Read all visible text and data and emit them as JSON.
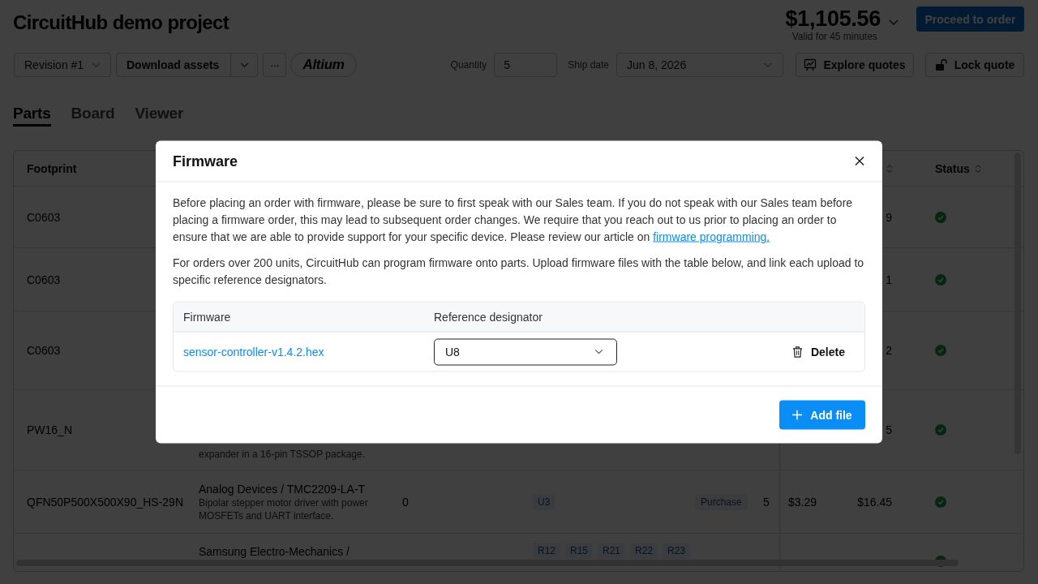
{
  "header": {
    "title": "CircuitHub demo project",
    "price": "$1,105.56",
    "price_note": "Valid for 45 minutes",
    "order_button": "Proceed to order"
  },
  "toolbar": {
    "revision": "Revision #1",
    "download": "Download assets",
    "more": "···",
    "cad_tool": "Altium",
    "quantity": {
      "label": "Quantity",
      "value": "5"
    },
    "ship_date": {
      "label": "Ship date",
      "value": "Jun 8, 2026"
    },
    "explore_button": "Explore quotes",
    "lock_button": "Lock quote"
  },
  "tabs": [
    {
      "label": "Parts",
      "selected": true
    },
    {
      "label": "Board",
      "selected": false
    },
    {
      "label": "Viewer",
      "selected": false
    }
  ],
  "table": {
    "columns": {
      "footprint": {
        "label": "Footprint"
      },
      "column_8": {
        "sortable": true
      },
      "status": {
        "label": "Status",
        "sortable": true
      }
    },
    "rows": [
      {
        "footprint": "C0603",
        "column_8": "9",
        "done": true
      },
      {
        "footprint": "C0603",
        "column_8": "1",
        "done": true
      },
      {
        "footprint": "C0603",
        "column_8": "2",
        "done": true
      },
      {
        "footprint": "PW16_N",
        "column_2": {
          "description": "expander in a 16-pin TSSOP package."
        },
        "column_8": "5",
        "done": true
      },
      {
        "footprint": "QFN50P500X500X90_HS-29N",
        "column_2": {
          "title": "Analog Devices / TMC2209-LA-T",
          "description": "Bipolar stepper motor driver with power MOSFETs and UART interface."
        },
        "column_3": "0",
        "column_4": [
          "U3"
        ],
        "column_5": "Purchase",
        "column_6": "5",
        "column_7": "$3.29",
        "column_8": "$16.45",
        "done": true
      },
      {
        "column_2": {
          "title": "Samsung Electro-Mechanics /"
        },
        "column_4": [
          "R12",
          "R15",
          "R21",
          "R22",
          "R23"
        ],
        "done": true
      }
    ]
  },
  "dialog": {
    "title": "Firmware",
    "paragraphs": [
      {
        "text": "Before placing an order with firmware, please be sure to first speak with our Sales team. If you do not speak with our Sales team before placing a firmware order, this may lead to subsequent order changes. We require that you reach out to us prior to placing an order to ensure that we are able to provide support for your specific device. Please review our article on",
        "link": "firmware programming."
      },
      {
        "text": "For orders over 200 units, CircuitHub can program firmware onto parts. Upload firmware files with the table below, and link each upload to specific reference designators."
      }
    ],
    "table": {
      "columns": [
        "Firmware",
        "Reference designator"
      ],
      "rows": [
        {
          "file": "sensor-controller-v1.4.2.hex",
          "reference_designator": "U8",
          "action": "Delete"
        }
      ]
    },
    "add_button": "Add file"
  }
}
